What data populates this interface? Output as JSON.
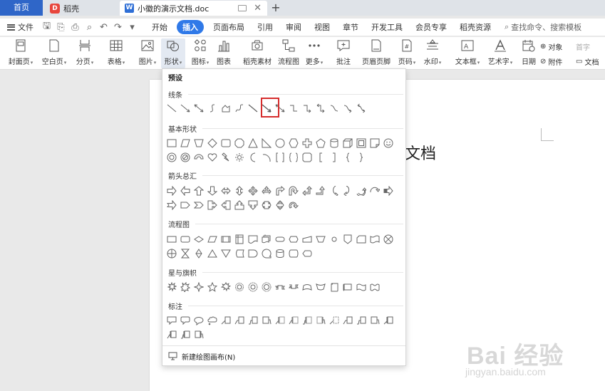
{
  "tabs": {
    "home": "首页",
    "daoke": "稻壳",
    "document": "小徽的演示文档.doc",
    "new_tab": "+"
  },
  "menubar": {
    "file": "文件",
    "items": [
      "开始",
      "插入",
      "页面布局",
      "引用",
      "审阅",
      "视图",
      "章节",
      "开发工具",
      "会员专享",
      "稻壳资源"
    ],
    "active_index": 1,
    "search": "查找命令、搜索模板"
  },
  "ribbon": {
    "items": [
      {
        "label": "封面页",
        "dropdown": true
      },
      {
        "label": "空白页",
        "dropdown": true
      },
      {
        "label": "分页",
        "dropdown": true
      },
      {
        "label": "表格",
        "dropdown": true
      },
      {
        "label": "图片",
        "dropdown": true
      },
      {
        "label": "形状",
        "dropdown": true
      },
      {
        "label": "图标",
        "dropdown": true
      },
      {
        "label": "图表",
        "dropdown": false
      },
      {
        "label": "稻壳素材",
        "dropdown": false
      },
      {
        "label": "流程图",
        "dropdown": false
      },
      {
        "label": "更多",
        "dropdown": true
      },
      {
        "label": "批注",
        "dropdown": false
      },
      {
        "label": "页眉页脚",
        "dropdown": false
      },
      {
        "label": "页码",
        "dropdown": true
      },
      {
        "label": "水印",
        "dropdown": true
      },
      {
        "label": "文本框",
        "dropdown": true
      },
      {
        "label": "艺术字",
        "dropdown": true
      },
      {
        "label": "日期",
        "dropdown": false
      }
    ],
    "object_label": "对象",
    "object_hint": "首字",
    "attachment_label": "附件",
    "docpart_label": "文档"
  },
  "document": {
    "visible_text": "文档"
  },
  "shapes_panel": {
    "preset_label": "预设",
    "sections": [
      "线条",
      "基本形状",
      "箭头总汇",
      "流程图",
      "星与旗帜",
      "标注"
    ],
    "new_canvas": "新建绘图画布(N)"
  },
  "watermark": {
    "main": "Bai 经验",
    "sub": "jingyan.baidu.com"
  },
  "colors": {
    "accent": "#2f79e8",
    "home_tab": "#2f66c8",
    "highlight": "#d62c2c"
  }
}
